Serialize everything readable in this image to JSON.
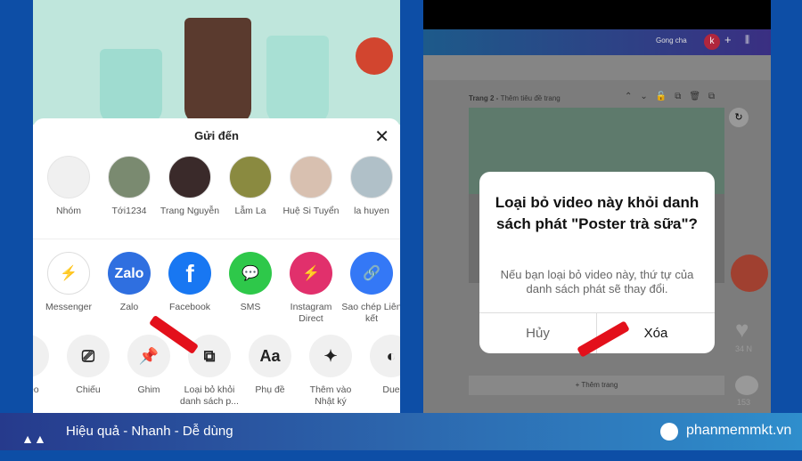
{
  "left": {
    "sheet_title": "Gửi đến",
    "contacts": [
      {
        "name": "Nhóm"
      },
      {
        "name": "Tới1234"
      },
      {
        "name": "Trang Nguyễn"
      },
      {
        "name": "Lẫm La"
      },
      {
        "name": "Huệ Si Tuyển"
      },
      {
        "name": "la huyen"
      }
    ],
    "apps": [
      {
        "label": "Messenger",
        "color": "#ffffff"
      },
      {
        "label": "Zalo",
        "color": "#2f6fe0"
      },
      {
        "label": "Facebook",
        "color": "#1877f2"
      },
      {
        "label": "SMS",
        "color": "#2ec84a"
      },
      {
        "label": "Instagram Direct",
        "color": "#e1306c"
      },
      {
        "label": "Sao chép Liên kết",
        "color": "#3478f6"
      }
    ],
    "app_glyphs": {
      "zalo": "Zalo",
      "facebook": "f"
    },
    "actions": [
      {
        "label": "video",
        "icon": "download-icon",
        "glyph": "⤓"
      },
      {
        "label": "Chiếu",
        "icon": "cast-icon",
        "glyph": "⎚"
      },
      {
        "label": "Ghim",
        "icon": "pin-icon",
        "glyph": "📌"
      },
      {
        "label": "Loại bỏ khỏi danh sách p...",
        "icon": "playlist-icon",
        "glyph": "⧉"
      },
      {
        "label": "Phụ đề",
        "icon": "captions-icon",
        "glyph": "Aa"
      },
      {
        "label": "Thêm vào Nhật ký",
        "icon": "sparkle-icon",
        "glyph": "✦"
      },
      {
        "label": "Due",
        "icon": "duet-icon",
        "glyph": "◐"
      }
    ]
  },
  "right": {
    "header_name": "Gong cha",
    "avatar_letter": "k",
    "page_label": "Trang 2 - ",
    "page_title_placeholder": "Thêm tiêu đề trang",
    "add_page": "+ Thêm trang",
    "likes": "34 N",
    "comments": "153",
    "dialog": {
      "title": "Loại bỏ video này khỏi danh sách phát \"Poster trà sữa\"?",
      "message": "Nếu bạn loại bỏ video này, thứ tự của danh sách phát sẽ thay đổi.",
      "cancel": "Hủy",
      "confirm": "Xóa"
    }
  },
  "footer": {
    "logo": "MKT",
    "slogan": "Hiệu quả - Nhanh - Dễ dùng",
    "website": "phanmemmkt.vn"
  },
  "colors": {
    "background": "#0d4ea6",
    "arrow": "#e3101b"
  }
}
